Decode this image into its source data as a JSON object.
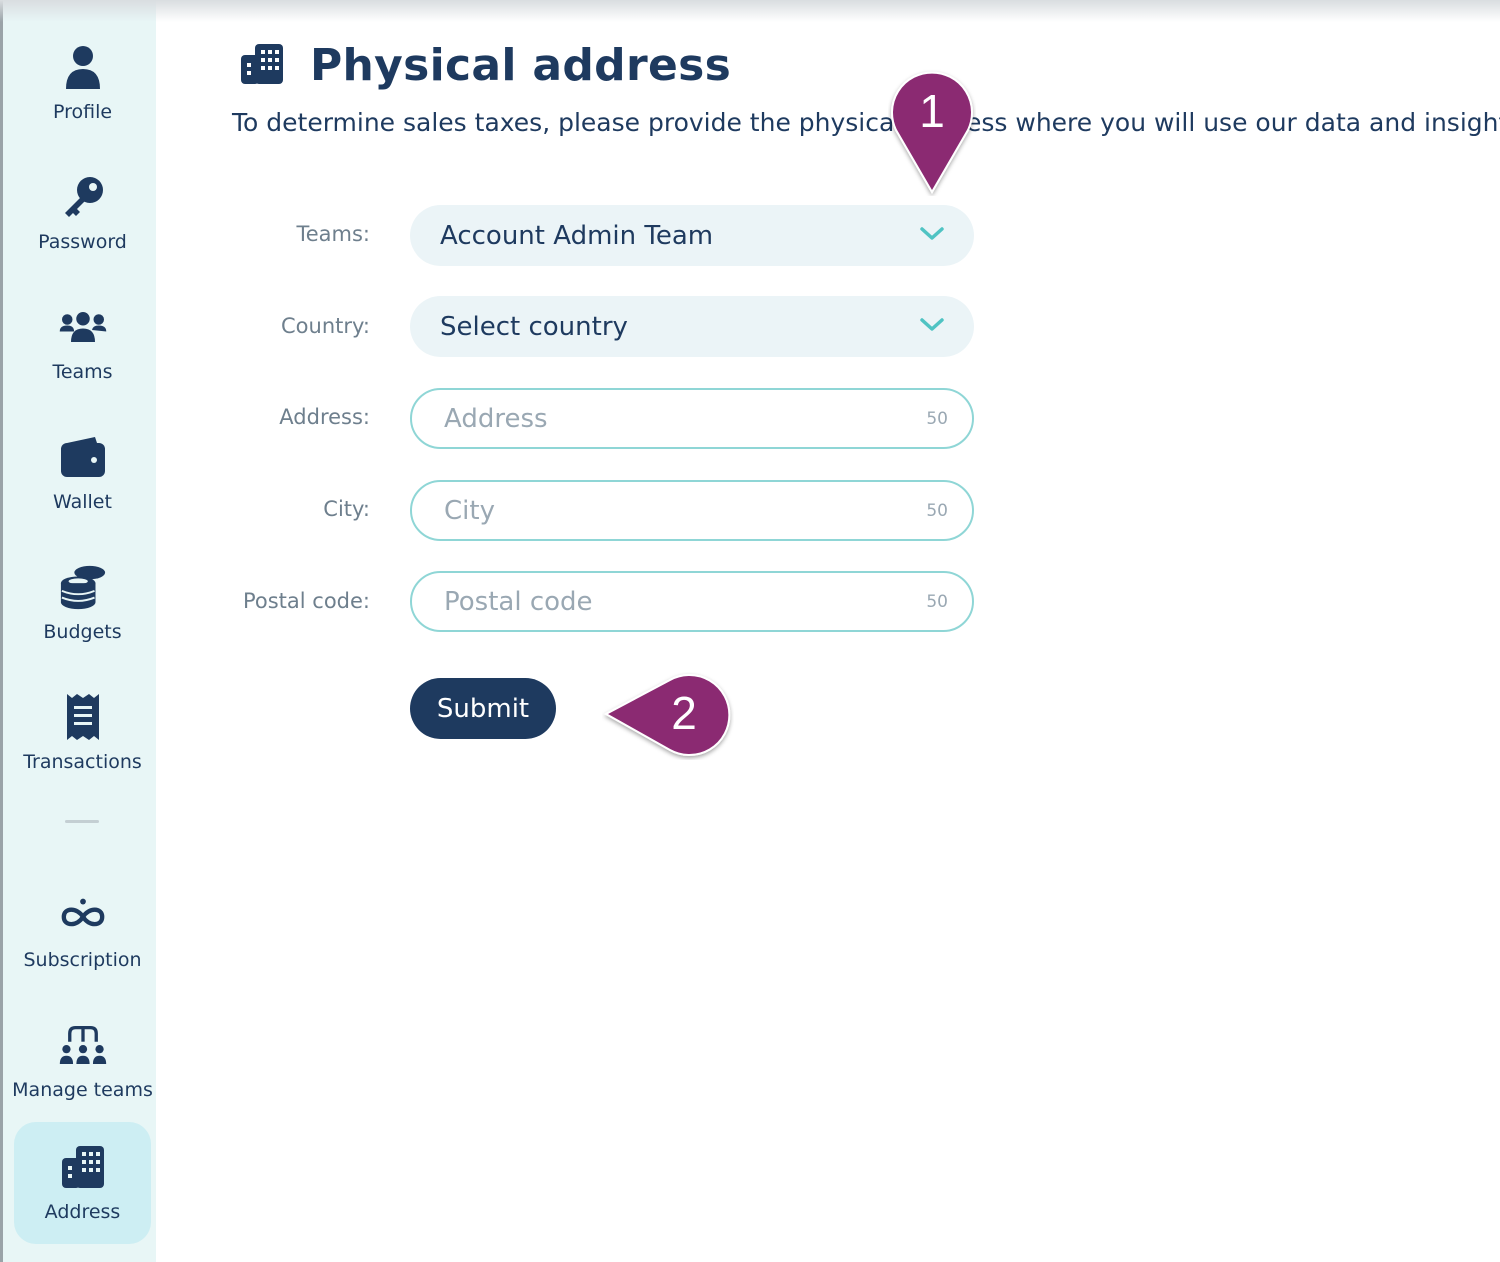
{
  "sidebar": {
    "items": [
      {
        "label": "Profile",
        "icon": "user-icon"
      },
      {
        "label": "Password",
        "icon": "key-icon"
      },
      {
        "label": "Teams",
        "icon": "users-icon"
      },
      {
        "label": "Wallet",
        "icon": "wallet-icon"
      },
      {
        "label": "Budgets",
        "icon": "coins-icon"
      },
      {
        "label": "Transactions",
        "icon": "receipt-icon"
      },
      {
        "label": "Subscription",
        "icon": "infinity-icon"
      },
      {
        "label": "Manage teams",
        "icon": "org-chart-icon"
      },
      {
        "label": "Address",
        "icon": "building-icon"
      }
    ],
    "active": "Address"
  },
  "header": {
    "title": "Physical address",
    "subtitle": "To determine sales taxes, please provide the physical address where you will use our data and insights."
  },
  "form": {
    "teams_label": "Teams:",
    "teams_value": "Account Admin Team",
    "country_label": "Country:",
    "country_value": "Select country",
    "address_label": "Address:",
    "address_placeholder": "Address",
    "address_max": "50",
    "city_label": "City:",
    "city_placeholder": "City",
    "city_max": "50",
    "postal_label": "Postal code:",
    "postal_placeholder": "Postal code",
    "postal_max": "50",
    "submit_label": "Submit"
  },
  "callouts": {
    "one": "1",
    "two": "2"
  },
  "colors": {
    "brand": "#1e3a5f",
    "accent": "#4fc3c3",
    "callout": "#8b2a72",
    "sidebar_bg": "#e8f6f6"
  }
}
